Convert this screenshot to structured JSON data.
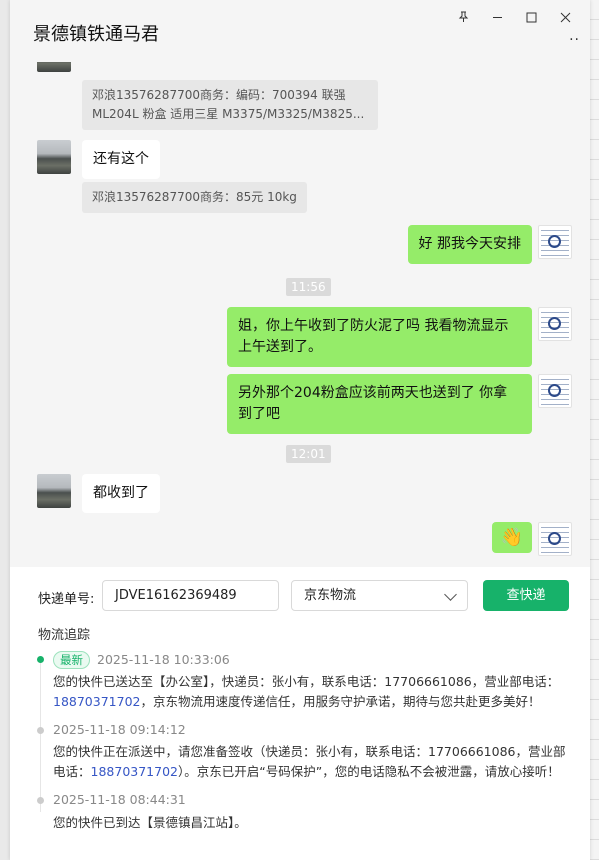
{
  "window": {
    "title": "景德镇铁通马君"
  },
  "chat": {
    "quote_1": "邓浪13576287700商务：编码：700394 联强 ML204L  粉盒 适用三星 M3375/M3325/M3825...",
    "msg_1": "还有这个",
    "quote_2": "邓浪13576287700商务：85元  10kg",
    "msg_2": "好  那我今天安排",
    "time_1": "11:56",
    "msg_3": "姐，你上午收到了防火泥了吗 我看物流显示上午送到了。",
    "msg_4": "另外那个204粉盒应该前两天也送到了  你拿到了吧",
    "time_2": "12:01",
    "msg_5": "都收到了",
    "msg_6_emoji": "👋"
  },
  "tracking": {
    "number_label": "快递单号:",
    "number_value": "JDVE16162369489",
    "carrier": "京东物流",
    "query_button": "查快递",
    "section_title": "物流追踪",
    "entries": [
      {
        "badge": "最新",
        "time": "2025-11-18 10:33:06",
        "text_a": "您的快件已送达至【办公室】，快递员：张小有，联系电话：17706661086，营业部电话：",
        "phone": "18870371702",
        "text_b": "，京东物流用速度传递信任，用服务守护承诺，期待与您共赴更多美好！"
      },
      {
        "time": "2025-11-18 09:14:12",
        "text_a": "您的快件正在派送中，请您准备签收（快递员：张小有，联系电话：17706661086，营业部电话：",
        "phone": "18870371702",
        "text_b": "）。京东已开启“号码保护”，您的电话隐私不会被泄露，请放心接听！"
      },
      {
        "time": "2025-11-18 08:44:31",
        "text_a": "您的快件已到达【景德镇昌江站】。"
      }
    ]
  },
  "colors": {
    "accent_green": "#17b26a",
    "bubble_green": "#95ec69",
    "phone_blue": "#3656c5"
  }
}
